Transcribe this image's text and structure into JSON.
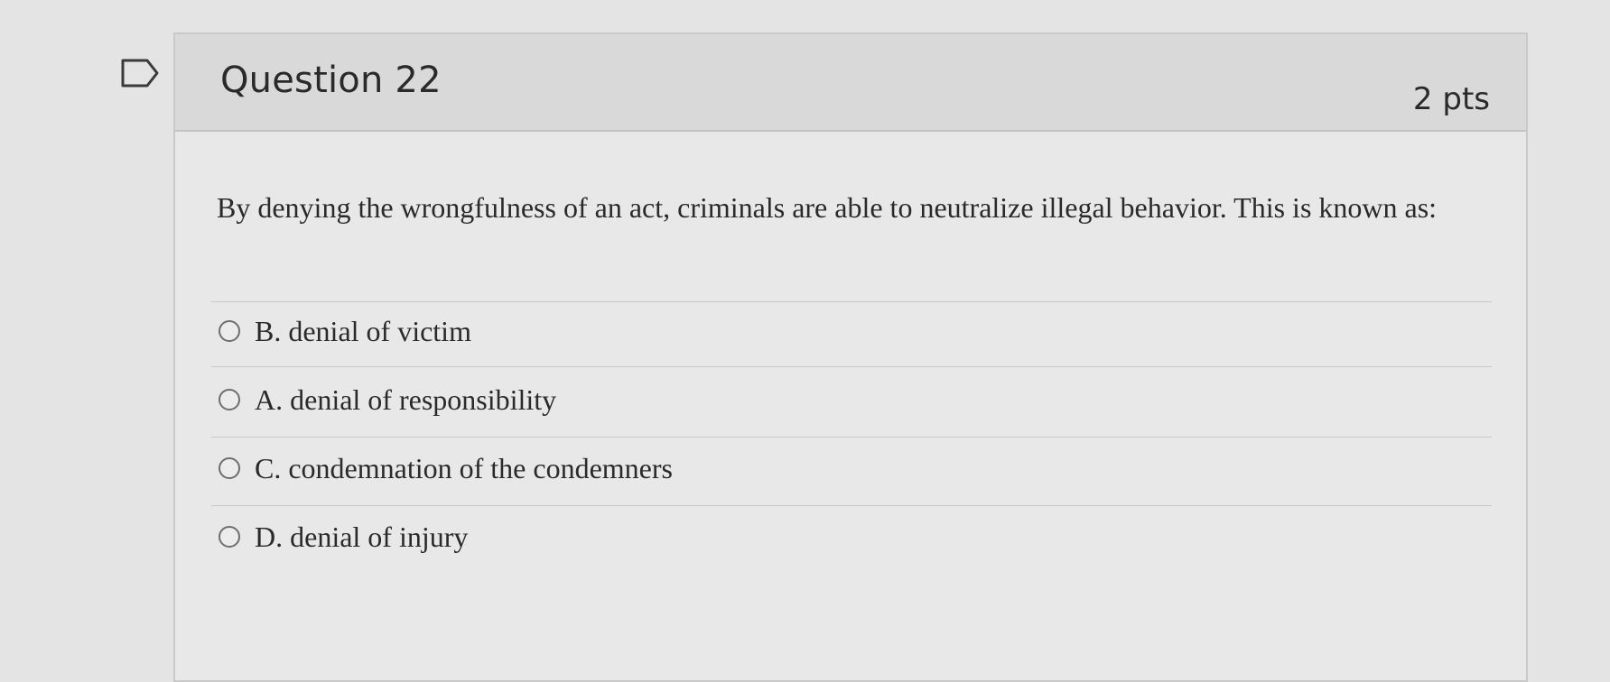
{
  "question": {
    "title": "Question 22",
    "points": "2 pts",
    "text": "By denying the wrongfulness of an act, criminals are able to neutralize illegal behavior. This is known as:"
  },
  "answers": [
    {
      "label": "B. denial of victim"
    },
    {
      "label": "A. denial of responsibility"
    },
    {
      "label": "C. condemnation of the condemners"
    },
    {
      "label": "D. denial of injury"
    }
  ],
  "icons": {
    "flag": "flag-outline-icon",
    "radio": "radio-unselected-icon"
  },
  "colors": {
    "header_bg": "#d9d9d9",
    "card_bg": "#e8e8e8",
    "text": "#2a2a2a"
  }
}
